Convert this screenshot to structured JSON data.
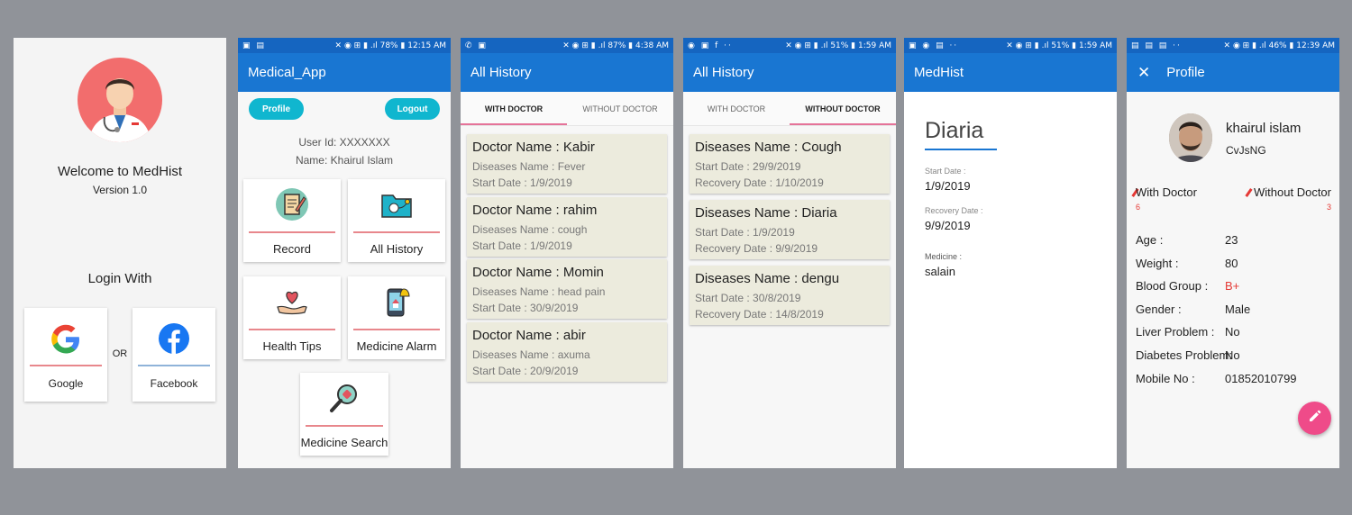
{
  "colors": {
    "appbar": "#1976d2",
    "statusbar": "#1565c0",
    "accent": "#e57399",
    "card": "#ecebdd",
    "fab": "#ef4b89"
  },
  "login": {
    "welcome": "Welcome to MedHist",
    "version": "Version 1.0",
    "login_with": "Login With",
    "or": "OR",
    "google": "Google",
    "facebook": "Facebook"
  },
  "home": {
    "status_left": "▣ ▤",
    "status_right": "✕ ◉ ⊞ ▮ .ıl 78% ▮ 12:15 AM",
    "title": "Medical_App",
    "profile_btn": "Profile",
    "logout_btn": "Logout",
    "user_id": "User Id: XXXXXXX",
    "name": "Name:  Khairul Islam",
    "tiles": [
      "Record",
      "All History",
      "Health Tips",
      "Medicine Alarm",
      "Medicine Search"
    ]
  },
  "history_doc": {
    "status_left": "✆ ▣",
    "status_right": "✕ ◉ ⊞ ▮ .ıl 87% ▮ 4:38 AM",
    "title": "All History",
    "tabs": [
      "WITH DOCTOR",
      "WITHOUT DOCTOR"
    ],
    "items": [
      {
        "title": "Doctor Name : Kabir",
        "line1": "Diseases Name : Fever",
        "line2": "Start Date : 1/9/2019"
      },
      {
        "title": "Doctor Name : rahim",
        "line1": "Diseases Name : cough",
        "line2": "Start Date : 1/9/2019"
      },
      {
        "title": "Doctor Name : Momin",
        "line1": "Diseases Name : head pain",
        "line2": "Start Date : 30/9/2019"
      },
      {
        "title": "Doctor Name : abir",
        "line1": "Diseases Name : axuma",
        "line2": "Start Date : 20/9/2019"
      }
    ]
  },
  "history_nodoc": {
    "status_left": "◉ ▣ f ··",
    "status_right": "✕ ◉ ⊞ ▮ .ıl 51% ▮ 1:59 AM",
    "title": "All History",
    "tabs": [
      "WITH DOCTOR",
      "WITHOUT DOCTOR"
    ],
    "items": [
      {
        "title": "Diseases Name : Cough",
        "line1": "Start Date : 29/9/2019",
        "line2": "Recovery Date : 1/10/2019"
      },
      {
        "title": "Diseases Name : Diaria",
        "line1": "Start Date : 1/9/2019",
        "line2": "Recovery Date : 9/9/2019"
      },
      {
        "title": "Diseases Name : dengu",
        "line1": "Start Date : 30/8/2019",
        "line2": "Recovery Date : 14/8/2019"
      }
    ]
  },
  "detail": {
    "status_left": "▣ ◉ ▤ ··",
    "status_right": "✕ ◉ ⊞ ▮ .ıl 51% ▮ 1:59 AM",
    "title": "MedHist",
    "disease": "Diaria",
    "start_label": "Start Date :",
    "start_value": "1/9/2019",
    "recovery_label": "Recovery Date :",
    "recovery_value": "9/9/2019",
    "medicine_label": "Medicine :",
    "medicine_value": "salain"
  },
  "profile": {
    "status_left": "▤ ▤ ▤ ··",
    "status_right": "✕ ◉ ⊞ ▮ .ıl 46% ▮ 12:39 AM",
    "title": "Profile",
    "name": "khairul islam",
    "code": "CvJsNG",
    "with_doctor": "With Doctor",
    "with_doctor_count": "6",
    "without_doctor": "Without Doctor",
    "without_doctor_count": "3",
    "rows": [
      {
        "label": "Age :",
        "value": "23"
      },
      {
        "label": "Weight :",
        "value": "80"
      },
      {
        "label": "Blood Group :",
        "value": "B+"
      },
      {
        "label": "Gender :",
        "value": "Male"
      },
      {
        "label": "Liver Problem :",
        "value": "No"
      },
      {
        "label": "Diabetes Problem:",
        "value": "No"
      },
      {
        "label": "Mobile No :",
        "value": "01852010799"
      }
    ]
  }
}
